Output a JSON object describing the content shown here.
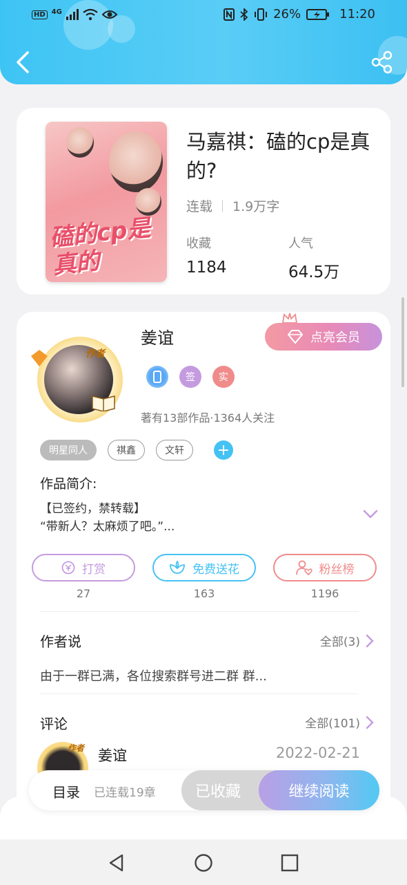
{
  "status_bar": {
    "hd": "HD",
    "network": "4G",
    "battery": "26%",
    "time": "11:20"
  },
  "book": {
    "title": "马嘉祺：磕的cp是真的?",
    "status": "连载",
    "word_count": "1.9万字",
    "favorites_label": "收藏",
    "favorites_value": "1184",
    "popularity_label": "人气",
    "popularity_value": "64.5万",
    "cover_text": "磕的cp是真的"
  },
  "author": {
    "tag": "作者",
    "name": "姜谊",
    "vip_label": "点亮会员",
    "badges": [
      "签",
      "实"
    ],
    "stats": "著有13部作品·1364人关注"
  },
  "tags": [
    "明星同人",
    "祺鑫",
    "文轩"
  ],
  "intro": {
    "title": "作品简介:",
    "line1": "【已签约，禁转载】",
    "line2": "“带新人？太麻烦了吧。”..."
  },
  "actions": [
    {
      "label": "打赏",
      "count": "27",
      "color": "#c59be0"
    },
    {
      "label": "免费送花",
      "count": "163",
      "color": "#45c2f4"
    },
    {
      "label": "粉丝榜",
      "count": "1196",
      "color": "#f08b8b"
    }
  ],
  "author_says": {
    "title": "作者说",
    "more": "全部(3)",
    "text": "由于一群已满，各位搜索群号进二群 群..."
  },
  "comments": {
    "title": "评论",
    "more": "全部(101)",
    "first": {
      "avatar_tag": "作者",
      "name": "姜谊",
      "date": "2022-02-21"
    }
  },
  "bottom_bar": {
    "toc": "目录",
    "chapters": "已连载19章",
    "collected": "已收藏",
    "continue": "继续阅读"
  },
  "colors": {
    "header": "#4cc8f5",
    "accent_blue": "#45c2f4",
    "accent_purple": "#c59be0",
    "accent_pink": "#f08b8b"
  }
}
